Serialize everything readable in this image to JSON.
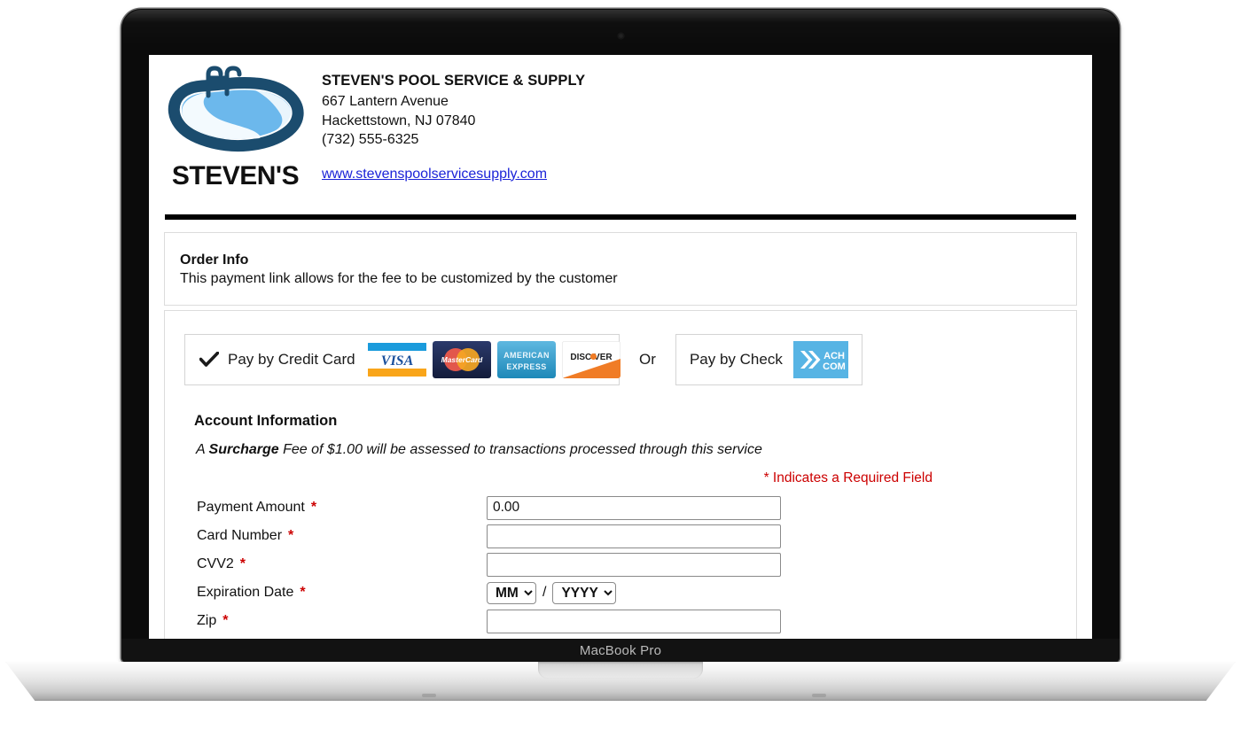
{
  "device": {
    "model_label": "MacBook Pro"
  },
  "header": {
    "logo_wordmark": "STEVEN'S",
    "company_name": "STEVEN'S POOL SERVICE & SUPPLY",
    "address_line1": "667 Lantern Avenue",
    "address_line2": "Hackettstown, NJ 07840",
    "phone": "(732) 555-6325",
    "website": "www.stevenspoolservicesupply.com",
    "link_color": "#1b23d8"
  },
  "order_info": {
    "title": "Order Info",
    "description": "This payment link allows for the fee to be customized by the customer"
  },
  "payment_methods": {
    "credit": {
      "label": "Pay by Credit Card",
      "selected": true,
      "cards": [
        "VISA",
        "MasterCard",
        "AMERICAN EXPRESS",
        "DISCOVER"
      ]
    },
    "or_label": "Or",
    "check": {
      "label": "Pay by Check",
      "logo_line1": "ACH",
      "logo_line2": "COM",
      "logo_color": "#57b4e4"
    }
  },
  "account_information": {
    "title": "Account Information",
    "surcharge_prefix": "A ",
    "surcharge_word": "Surcharge",
    "surcharge_suffix": " Fee of $1.00 will be assessed to transactions processed through this service",
    "required_note": "* Indicates a Required Field",
    "required_color": "#cc0000",
    "fields": [
      {
        "label": "Payment Amount",
        "required": "*",
        "value": "0.00",
        "placeholder": ""
      },
      {
        "label": "Card Number",
        "required": "*",
        "value": "",
        "placeholder": ""
      },
      {
        "label": "CVV2",
        "required": "*",
        "value": "",
        "placeholder": ""
      },
      {
        "label": "Zip",
        "required": "*",
        "value": "",
        "placeholder": ""
      }
    ],
    "expiration": {
      "label": "Expiration Date",
      "required": "*",
      "month_value": "MM",
      "year_value": "YYYY",
      "separator": "/"
    }
  }
}
